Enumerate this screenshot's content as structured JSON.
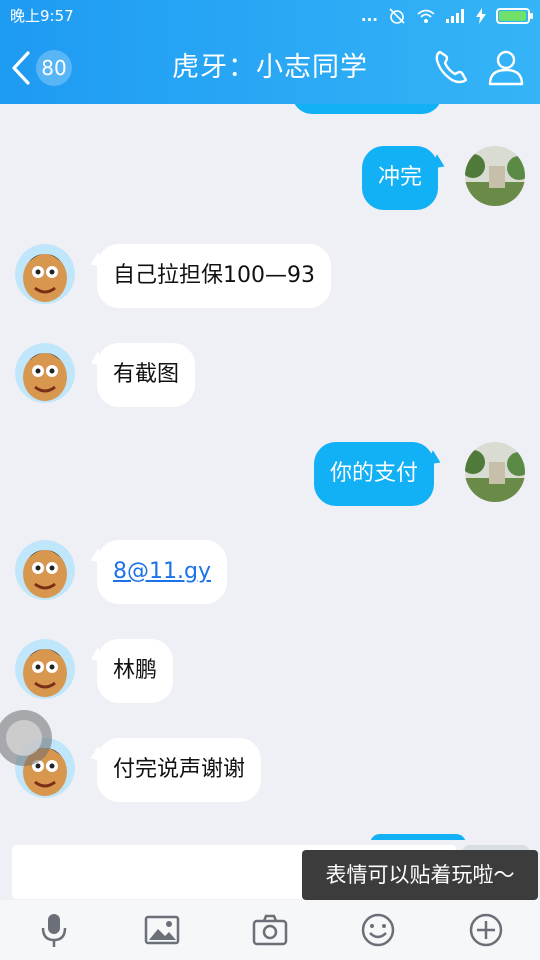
{
  "status_bar": {
    "time": "晚上9:57",
    "signal_dots": "...",
    "icons": [
      "alarm-off-icon",
      "wifi-icon",
      "signal-icon",
      "charging-icon",
      "battery-icon"
    ],
    "battery_level": 0.9
  },
  "header": {
    "back_badge": "80",
    "title": "虎牙：小志同学",
    "call_icon": "phone-icon",
    "profile_icon": "user-icon",
    "colors": {
      "gradient_start": "#1e9bf2",
      "gradient_end": "#35b4f7"
    }
  },
  "messages": [
    {
      "side": "out",
      "text": "",
      "partial": true
    },
    {
      "side": "out",
      "text": "冲完"
    },
    {
      "side": "in",
      "text": "自己拉担保100—93"
    },
    {
      "side": "in",
      "text": "有截图"
    },
    {
      "side": "out",
      "text": "你的支付"
    },
    {
      "side": "in",
      "text": "8@11.gy",
      "is_link": true
    },
    {
      "side": "in",
      "text": "林鹏"
    },
    {
      "side": "in",
      "text": "付完说声谢谢"
    },
    {
      "side": "out",
      "text": "",
      "partial": true
    }
  ],
  "composer": {
    "input_value": "",
    "tooltip": "表情可以贴着玩啦～"
  },
  "toolbar": {
    "icons": [
      "microphone-icon",
      "image-icon",
      "camera-icon",
      "emoji-icon",
      "plus-icon"
    ]
  },
  "colors": {
    "bubble_out": "#12b0f5",
    "bubble_in": "#ffffff",
    "background": "#eef0f5",
    "link": "#1a73e8"
  }
}
